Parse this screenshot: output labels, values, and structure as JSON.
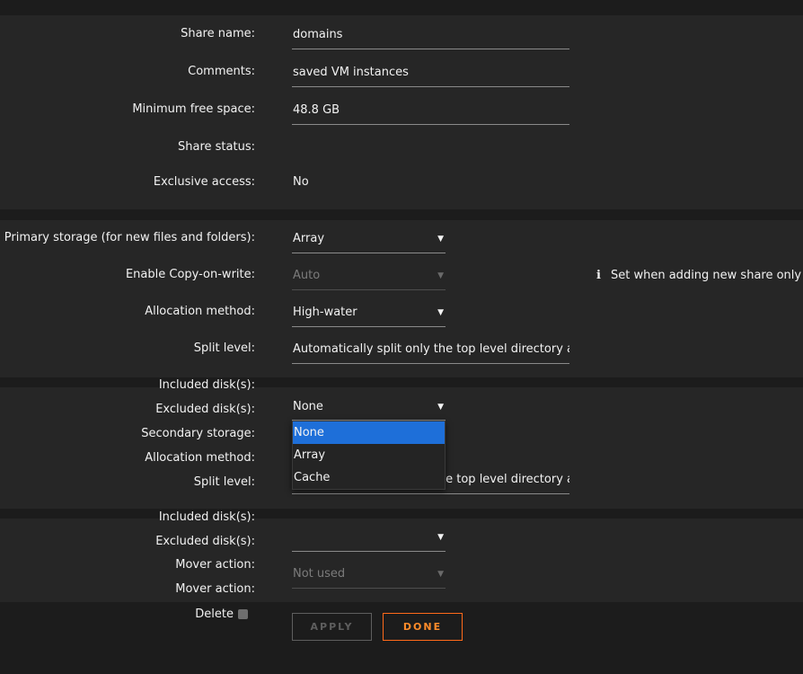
{
  "share": {
    "name_label": "Share name:",
    "name_value": "domains",
    "comments_label": "Comments:",
    "comments_value": "saved VM instances",
    "min_free_label": "Minimum free space:",
    "min_free_value": "48.8 GB",
    "status_label": "Share status:",
    "status_value": "",
    "exclusive_label": "Exclusive access:",
    "exclusive_value": "No"
  },
  "primary": {
    "storage_label": "Primary storage (for new files and folders):",
    "storage_value": "Array",
    "cow_label": "Enable Copy-on-write:",
    "cow_value": "Auto",
    "cow_info": "Set when adding new share only",
    "alloc_label": "Allocation method:",
    "alloc_value": "High-water",
    "split_label": "Split level:",
    "split_value": "Automatically split only the top level directory as required",
    "included_label": "Included disk(s):",
    "excluded_label": "Excluded disk(s):",
    "excluded_value": "None"
  },
  "secondary": {
    "storage_label": "Secondary storage:",
    "alloc_label": "Allocation method:",
    "split_label": "Split level:",
    "split_value": "Automatically split only the top level directory as required",
    "included_label": "Included disk(s):",
    "excluded_label": "Excluded disk(s):",
    "excluded_value": "",
    "mover_label": "Mover action:",
    "mover_value": "Not used",
    "mover2_label": "Mover action:"
  },
  "dropdown": {
    "options": [
      "None",
      "Array",
      "Cache"
    ],
    "selected": "None"
  },
  "footer": {
    "delete_label": "Delete",
    "apply_label": "APPLY",
    "done_label": "DONE"
  },
  "colors": {
    "accent": "#ff6a1a",
    "selected_option": "#1e6fd9",
    "background": "#1c1c1c",
    "band": "#262626"
  }
}
